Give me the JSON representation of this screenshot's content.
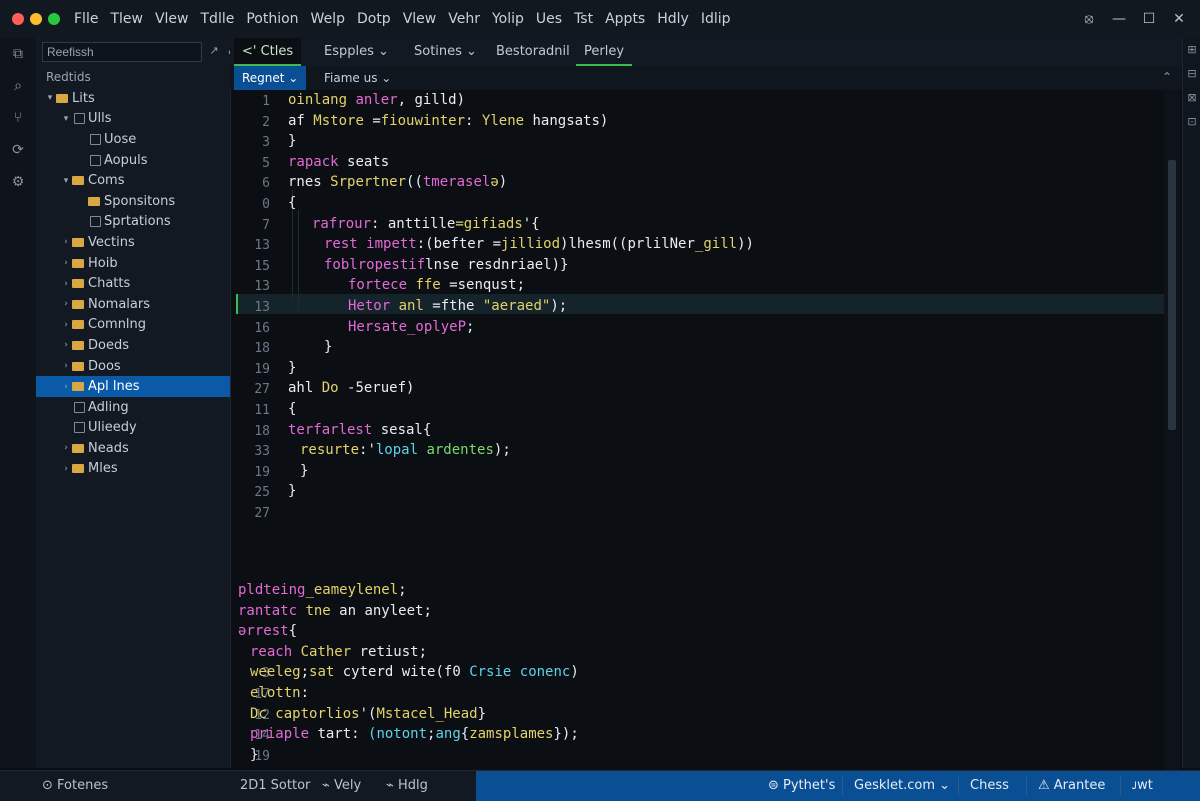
{
  "menu": [
    "Flle",
    "Tlew",
    "Vlew",
    "Tdlle",
    "Pothion",
    "Welp",
    "Dotp",
    "Vlew",
    "Vehr",
    "Yolip",
    "Ues",
    "Tst",
    "Appts",
    "Hdly",
    "Idlip"
  ],
  "window_controls": [
    "⦻",
    "—",
    "☐",
    "✕"
  ],
  "activity_icons": [
    "explorer-icon",
    "search-icon",
    "source-control-icon",
    "debug-icon",
    "extensions-icon"
  ],
  "sidebar": {
    "search_value": "Reefissh",
    "search_button": "↗",
    "collapse": "↙",
    "header": "Redtids",
    "items": [
      {
        "label": "Lits",
        "depth": 0,
        "arrow": "▾",
        "type": "folder"
      },
      {
        "label": "Ulls",
        "depth": 1,
        "arrow": "▾",
        "type": "file"
      },
      {
        "label": "Uose",
        "depth": 2,
        "arrow": "",
        "type": "file"
      },
      {
        "label": "Aopuls",
        "depth": 2,
        "arrow": "",
        "type": "file"
      },
      {
        "label": "Coms",
        "depth": 1,
        "arrow": "▾",
        "type": "folder"
      },
      {
        "label": "Sponsitons",
        "depth": 2,
        "arrow": "",
        "type": "folder"
      },
      {
        "label": "Sprtations",
        "depth": 2,
        "arrow": "",
        "type": "file"
      },
      {
        "label": "Vectins",
        "depth": 1,
        "arrow": "›",
        "type": "folder"
      },
      {
        "label": "Hoib",
        "depth": 1,
        "arrow": "›",
        "type": "folder"
      },
      {
        "label": "Chatts",
        "depth": 1,
        "arrow": "›",
        "type": "folder"
      },
      {
        "label": "Nomalars",
        "depth": 1,
        "arrow": "›",
        "type": "folder"
      },
      {
        "label": "Comnlng",
        "depth": 1,
        "arrow": "›",
        "type": "folder"
      },
      {
        "label": "Doeds",
        "depth": 1,
        "arrow": "›",
        "type": "folder"
      },
      {
        "label": "Doos",
        "depth": 1,
        "arrow": "›",
        "type": "folder"
      },
      {
        "label": "Apl lnes",
        "depth": 1,
        "arrow": "›",
        "type": "folder",
        "selected": true
      },
      {
        "label": "Adling",
        "depth": 1,
        "arrow": "",
        "type": "file"
      },
      {
        "label": "Ulieedy",
        "depth": 1,
        "arrow": "",
        "type": "file"
      },
      {
        "label": "Neads",
        "depth": 1,
        "arrow": "›",
        "type": "folder"
      },
      {
        "label": "Mles",
        "depth": 1,
        "arrow": "›",
        "type": "folder"
      }
    ]
  },
  "tabs": [
    {
      "label": "<' Ctles",
      "active": true
    },
    {
      "label": "Espples ⌄"
    },
    {
      "label": "Sotines ⌄"
    },
    {
      "label": "Bestoradnil"
    },
    {
      "label": "Perley",
      "underline": true
    }
  ],
  "subtabs": [
    {
      "label": "Regnet ⌄",
      "active": true
    },
    {
      "label": "Fiame us ⌄"
    }
  ],
  "subtabs_collapse": "⌃",
  "editor_lines": [
    {
      "n": "1",
      "indent": 0,
      "segs": [
        [
          "yellow",
          "oinlang "
        ],
        [
          "pink",
          "anler"
        ],
        [
          "white",
          ", gilld)"
        ]
      ]
    },
    {
      "n": "2",
      "indent": 0,
      "segs": [
        [
          "white",
          "af "
        ],
        [
          "yellow",
          "Mstore "
        ],
        [
          "white",
          "="
        ],
        [
          "yellow",
          "fiouwinter"
        ],
        [
          "white",
          ": "
        ],
        [
          "yellow",
          "Ylene "
        ],
        [
          "white",
          "hangsats)"
        ]
      ]
    },
    {
      "n": "3",
      "indent": 0,
      "segs": [
        [
          "white",
          "}"
        ]
      ]
    },
    {
      "n": "5",
      "indent": 0,
      "segs": [
        [
          "pink",
          "rapack "
        ],
        [
          "white",
          "seats"
        ]
      ]
    },
    {
      "n": "6",
      "indent": 0,
      "segs": [
        [
          "white",
          "rnes "
        ],
        [
          "yellow",
          "Srpertner"
        ],
        [
          "white",
          "(("
        ],
        [
          "pink",
          "tmerasel"
        ],
        [
          "yellow",
          "ə"
        ],
        [
          "white",
          ")"
        ]
      ]
    },
    {
      "n": "0",
      "indent": 0,
      "segs": [
        [
          "white",
          "{"
        ]
      ]
    },
    {
      "n": "7",
      "indent": 2,
      "segs": [
        [
          "pink",
          "rafrour"
        ],
        [
          "white",
          ": "
        ],
        [
          "white",
          "anttille"
        ],
        [
          "yellow",
          "=gifiads"
        ],
        [
          "white",
          "'{"
        ]
      ]
    },
    {
      "n": "13",
      "indent": 3,
      "segs": [
        [
          "pink",
          "rest "
        ],
        [
          "pink",
          "impett"
        ],
        [
          "white",
          ":(befter "
        ],
        [
          "white",
          "="
        ],
        [
          "yellow",
          "jilliod"
        ],
        [
          "white",
          ")lhesm(("
        ],
        [
          "white",
          "prlilNer"
        ],
        [
          "yellow",
          "_gill"
        ],
        [
          "white",
          "))"
        ]
      ]
    },
    {
      "n": "15",
      "indent": 3,
      "segs": [
        [
          "pink",
          "foblropestif"
        ],
        [
          "white",
          "lnse "
        ],
        [
          "white",
          "resdnriael)}"
        ]
      ]
    },
    {
      "n": "13",
      "indent": 5,
      "segs": [
        [
          "pink",
          "fortece "
        ],
        [
          "yellow",
          "ffe "
        ],
        [
          "white",
          "=senqust;"
        ]
      ]
    },
    {
      "n": "13",
      "indent": 5,
      "segs": [
        [
          "pink",
          "Hetor "
        ],
        [
          "yellow",
          "anl "
        ],
        [
          "white",
          "=fthe "
        ],
        [
          "yellow",
          "\"aeraed\""
        ],
        [
          "white",
          ");"
        ]
      ]
    },
    {
      "n": "16",
      "indent": 5,
      "segs": [
        [
          "pink",
          "Hersate_oplyeP"
        ],
        [
          "white",
          ";"
        ]
      ]
    },
    {
      "n": "18",
      "indent": 3,
      "segs": [
        [
          "white",
          "}"
        ]
      ]
    },
    {
      "n": "19",
      "indent": 0,
      "segs": [
        [
          "white",
          "}"
        ]
      ]
    },
    {
      "n": "27",
      "indent": 0,
      "segs": [
        [
          "white",
          "ahl "
        ],
        [
          "yellow",
          "Do "
        ],
        [
          "white",
          "-5eruef)"
        ]
      ]
    },
    {
      "n": "11",
      "indent": 0,
      "segs": [
        [
          "white",
          "{"
        ]
      ]
    },
    {
      "n": "18",
      "indent": 0,
      "segs": [
        [
          "pink",
          "terfarlest "
        ],
        [
          "white",
          "sesal{"
        ]
      ]
    },
    {
      "n": "33",
      "indent": 1,
      "segs": [
        [
          "yellow",
          "resurte"
        ],
        [
          "white",
          ":'"
        ],
        [
          "cyan",
          "lopal "
        ],
        [
          "green",
          "ardentes"
        ],
        [
          "white",
          ");"
        ]
      ]
    },
    {
      "n": "19",
      "indent": 1,
      "segs": [
        [
          "white",
          "}"
        ]
      ]
    },
    {
      "n": "25",
      "indent": 0,
      "segs": [
        [
          "white",
          "}"
        ]
      ]
    },
    {
      "n": "27",
      "indent": 0,
      "segs": []
    }
  ],
  "lower_lines": [
    {
      "n": "",
      "indent": 0,
      "segs": [
        [
          "pink",
          "pldteing"
        ],
        [
          "yellow",
          "_eameylenel"
        ],
        [
          "white",
          ";"
        ]
      ]
    },
    {
      "n": "",
      "indent": 0,
      "segs": [
        [
          "pink",
          "rantatc "
        ],
        [
          "yellow",
          "tne "
        ],
        [
          "white",
          "an "
        ],
        [
          "white",
          "anyleet;"
        ]
      ]
    },
    {
      "n": "",
      "indent": 0,
      "segs": [
        [
          "pink",
          "ərrest"
        ],
        [
          "white",
          "{"
        ]
      ]
    },
    {
      "n": "",
      "indent": 1,
      "segs": [
        [
          "pink",
          "reach "
        ],
        [
          "yellow",
          "Cather "
        ],
        [
          "white",
          "retiust;"
        ]
      ]
    },
    {
      "n": "3",
      "indent": 1,
      "segs": [
        [
          "yellow",
          "weeleg"
        ],
        [
          "white",
          ";"
        ],
        [
          "yellow",
          "sat "
        ],
        [
          "white",
          "cyterd "
        ],
        [
          "white",
          "wite"
        ],
        [
          "white",
          "(f0 "
        ],
        [
          "cyan",
          "Crsie "
        ],
        [
          "cyan",
          "conenc"
        ],
        [
          "white",
          ")"
        ]
      ]
    },
    {
      "n": "17",
      "indent": 1,
      "segs": [
        [
          "yellow",
          "elottn"
        ],
        [
          "white",
          ":"
        ]
      ]
    },
    {
      "n": "12",
      "indent": 1,
      "segs": [
        [
          "yellow",
          "Dc "
        ],
        [
          "yellow",
          "captorlios"
        ],
        [
          "white",
          "'("
        ],
        [
          "yellow",
          "Mstacel_Head"
        ],
        [
          "white",
          "}"
        ]
      ]
    },
    {
      "n": "14",
      "indent": 1,
      "segs": [
        [
          "pink",
          "priaple "
        ],
        [
          "white",
          "tart"
        ],
        [
          "white",
          ": "
        ],
        [
          "cyan",
          "(notont"
        ],
        [
          "white",
          ";"
        ],
        [
          "cyan",
          "ang"
        ],
        [
          "white",
          "{"
        ],
        [
          "yellow",
          "zamsplames"
        ],
        [
          "white",
          "});"
        ]
      ]
    },
    {
      "n": "19",
      "indent": 1,
      "segs": [
        [
          "white",
          "}"
        ]
      ]
    }
  ],
  "statusbar": {
    "left": "⊙ Fotenes",
    "mid1": "2D1 Sottor",
    "mid2": "⌁ Vely",
    "mid3": "⌁ Hdlg",
    "right": [
      "⊜ Pythet's",
      "Gesklet.com ⌄",
      "Chess",
      "⚠ Arantee",
      "ᴊwt"
    ]
  },
  "rightbar_icons": [
    "⊞",
    "⊟",
    "⊠",
    "⊡"
  ]
}
